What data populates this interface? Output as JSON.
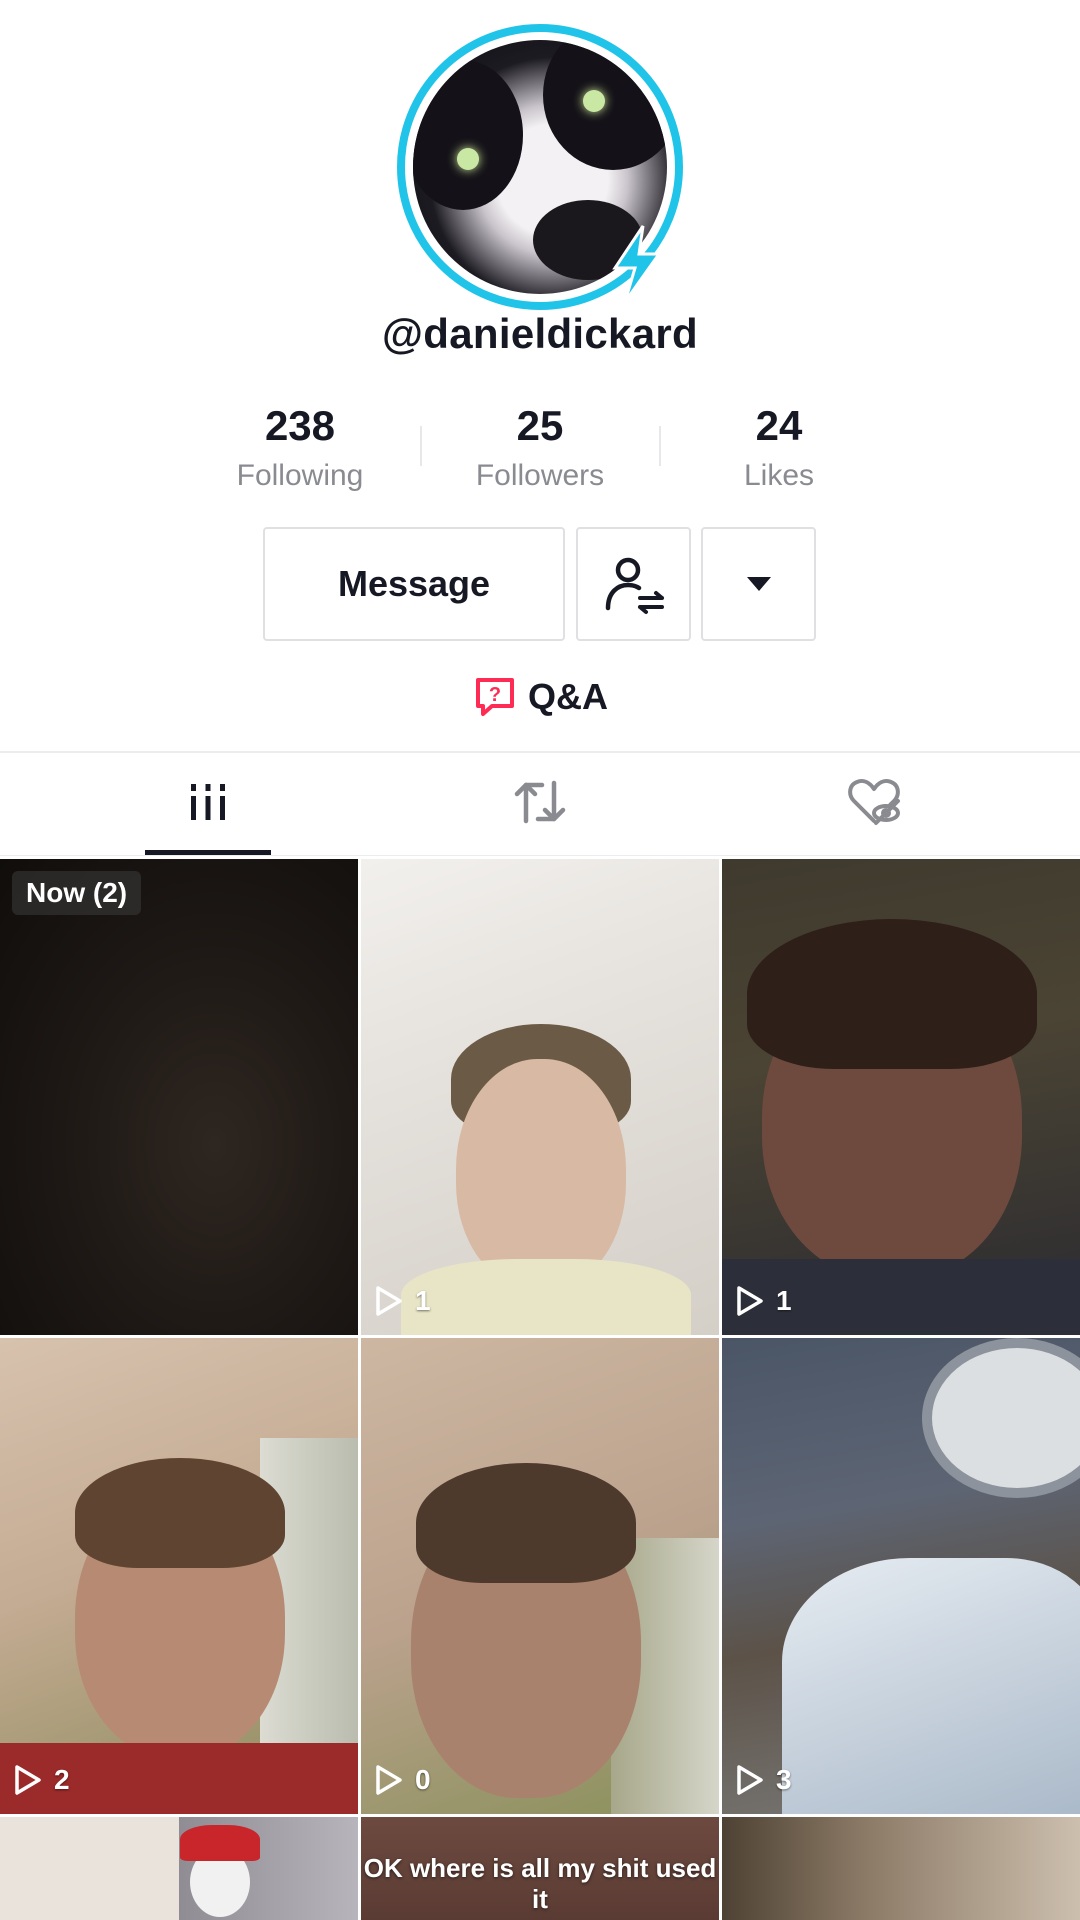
{
  "profile": {
    "username": "@danieldickard",
    "stats": [
      {
        "value": "238",
        "label": "Following"
      },
      {
        "value": "25",
        "label": "Followers"
      },
      {
        "value": "24",
        "label": "Likes"
      }
    ]
  },
  "actions": {
    "message_label": "Message",
    "follow_icon": "person-swap-icon",
    "more_icon": "caret-down-icon"
  },
  "qa": {
    "label": "Q&A",
    "icon": "question-bubble-icon"
  },
  "tabs": [
    {
      "name": "videos",
      "icon": "grid-icon",
      "active": true
    },
    {
      "name": "reposts",
      "icon": "repost-icon",
      "active": false
    },
    {
      "name": "liked",
      "icon": "hidden-heart-icon",
      "active": false
    }
  ],
  "videos": [
    {
      "badge": "Now (2)",
      "views": ""
    },
    {
      "views": "1"
    },
    {
      "views": "1"
    },
    {
      "views": "2"
    },
    {
      "views": "0"
    },
    {
      "views": "3"
    },
    {
      "views": ""
    },
    {
      "caption": "OK where is all my shit used it",
      "views": ""
    },
    {
      "views": ""
    }
  ],
  "colors": {
    "accent": "#20c4e8",
    "qa_icon": "#fe2c55",
    "text": "#161823",
    "muted": "#8a8b91"
  }
}
